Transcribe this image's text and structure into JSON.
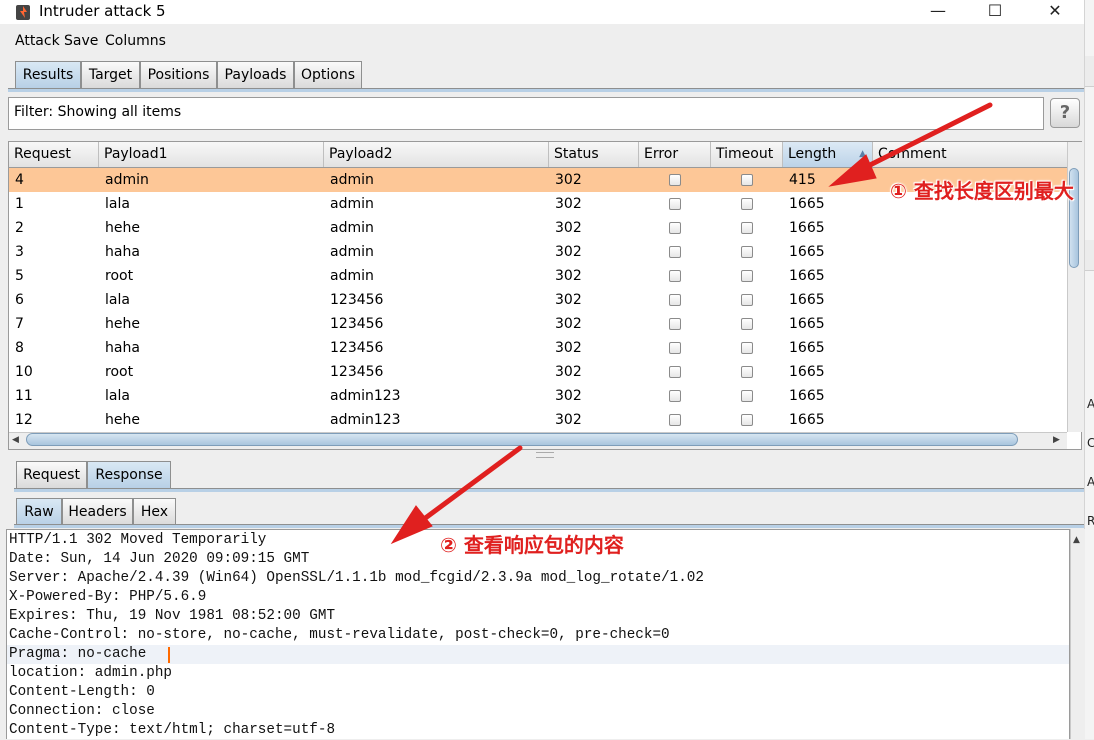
{
  "window": {
    "title": "Intruder attack 5",
    "controls": {
      "minimize": "—",
      "maximize": "☐",
      "close": "✕"
    }
  },
  "menu": [
    "Attack",
    "Save",
    "Columns"
  ],
  "main_tabs": [
    {
      "label": "Results",
      "selected": true
    },
    {
      "label": "Target",
      "selected": false
    },
    {
      "label": "Positions",
      "selected": false
    },
    {
      "label": "Payloads",
      "selected": false
    },
    {
      "label": "Options",
      "selected": false
    }
  ],
  "filter": {
    "text": "Filter: Showing all items",
    "help": "?"
  },
  "table": {
    "columns": [
      "Request",
      "Payload1",
      "Payload2",
      "Status",
      "Error",
      "Timeout",
      "Length",
      "Comment"
    ],
    "sorted_column": "Length",
    "sort_glyph": "▲",
    "rows": [
      {
        "request": "4",
        "payload1": "admin",
        "payload2": "admin",
        "status": "302",
        "length": "415",
        "selected": true
      },
      {
        "request": "1",
        "payload1": "lala",
        "payload2": "admin",
        "status": "302",
        "length": "1665"
      },
      {
        "request": "2",
        "payload1": "hehe",
        "payload2": "admin",
        "status": "302",
        "length": "1665"
      },
      {
        "request": "3",
        "payload1": "haha",
        "payload2": "admin",
        "status": "302",
        "length": "1665"
      },
      {
        "request": "5",
        "payload1": "root",
        "payload2": "admin",
        "status": "302",
        "length": "1665"
      },
      {
        "request": "6",
        "payload1": "lala",
        "payload2": "123456",
        "status": "302",
        "length": "1665"
      },
      {
        "request": "7",
        "payload1": "hehe",
        "payload2": "123456",
        "status": "302",
        "length": "1665"
      },
      {
        "request": "8",
        "payload1": "haha",
        "payload2": "123456",
        "status": "302",
        "length": "1665"
      },
      {
        "request": "10",
        "payload1": "root",
        "payload2": "123456",
        "status": "302",
        "length": "1665"
      },
      {
        "request": "11",
        "payload1": "lala",
        "payload2": "admin123",
        "status": "302",
        "length": "1665"
      },
      {
        "request": "12",
        "payload1": "hehe",
        "payload2": "admin123",
        "status": "302",
        "length": "1665"
      }
    ]
  },
  "detail_tabs": [
    {
      "label": "Request",
      "selected": false
    },
    {
      "label": "Response",
      "selected": true
    }
  ],
  "view_tabs": [
    {
      "label": "Raw",
      "selected": true
    },
    {
      "label": "Headers",
      "selected": false
    },
    {
      "label": "Hex",
      "selected": false
    }
  ],
  "response_lines": [
    "HTTP/1.1 302 Moved Temporarily",
    "Date: Sun, 14 Jun 2020 09:09:15 GMT",
    "Server: Apache/2.4.39 (Win64) OpenSSL/1.1.1b mod_fcgid/2.3.9a mod_log_rotate/1.02",
    "X-Powered-By: PHP/5.6.9",
    "Expires: Thu, 19 Nov 1981 08:52:00 GMT",
    "Cache-Control: no-store, no-cache, must-revalidate, post-check=0, pre-check=0",
    "Pragma: no-cache",
    "location: admin.php",
    "Content-Length: 0",
    "Connection: close",
    "Content-Type: text/html; charset=utf-8"
  ],
  "annotations": {
    "note1": "① 查找长度区别最大",
    "note2": "② 查看响应包的内容",
    "arrow_color": "#e0201f"
  },
  "right_strip": [
    "A",
    "C",
    "A",
    "R"
  ],
  "colors": {
    "selected_row": "#fdc797",
    "tab_selected": "#b8d0e6",
    "caret": "#ff6a00"
  }
}
